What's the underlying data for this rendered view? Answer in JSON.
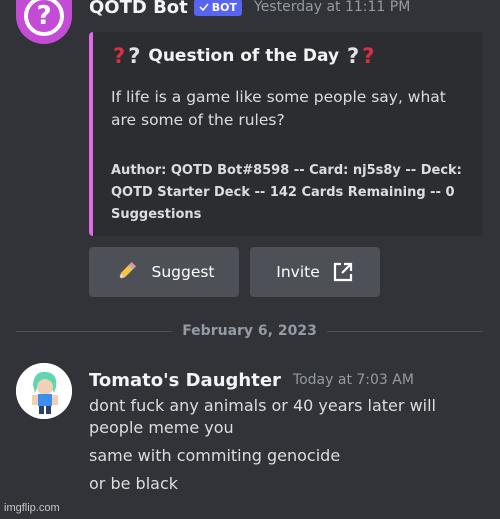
{
  "colors": {
    "background": "#313338",
    "embed_background": "#2b2d31",
    "embed_accent": "#e069e8",
    "bot_badge": "#5865f2",
    "button": "#4e5058",
    "bot_avatar": "#c44bd6"
  },
  "bot_message": {
    "avatar_icon": "question-mark-icon",
    "username": "QOTD Bot",
    "badge": "BOT",
    "timestamp": "Yesterday at 11:11 PM",
    "embed": {
      "title": "Question of the Day",
      "description": "If life is a game like some people say, what are some of the rules?",
      "footer": "Author: QOTD Bot#8598 -- Card: nj5s8y -- Deck: QOTD Starter Deck -- 142 Cards Remaining -- 0 Suggestions"
    },
    "buttons": {
      "suggest": "Suggest",
      "invite": "Invite"
    }
  },
  "date_divider": "February 6, 2023",
  "user_message": {
    "username": "Tomato's Daughter",
    "timestamp": "Today at 7:03 AM",
    "lines": [
      "dont fuck any animals or 40 years later will",
      "people meme you",
      "same with commiting genocide",
      "or be black"
    ]
  },
  "watermark": "imgflip.com"
}
